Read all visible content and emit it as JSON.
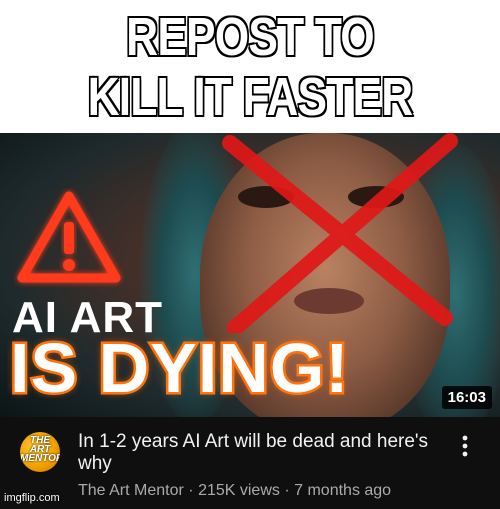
{
  "meme": {
    "caption_line_1": "REPOST TO",
    "caption_line_2": "KILL IT FASTER",
    "caption_color": "#ffffff"
  },
  "thumbnail": {
    "text_line_1": "AI ART",
    "text_line_2": "IS DYING!",
    "duration": "16:03",
    "warning_icon": "warning-triangle-icon",
    "cross_icon": "red-x-icon",
    "accent_color": "#ff7a18",
    "cross_color": "#e01818"
  },
  "video": {
    "title": "In 1-2 years AI Art will be dead and here's why",
    "channel": "The Art Mentor",
    "views": "215K views",
    "age": "7 months ago",
    "separator": "·",
    "avatar_text": "THE ART MENTOR",
    "more_icon": "more-vertical-icon"
  },
  "watermark": {
    "text": "imgflip.com"
  }
}
